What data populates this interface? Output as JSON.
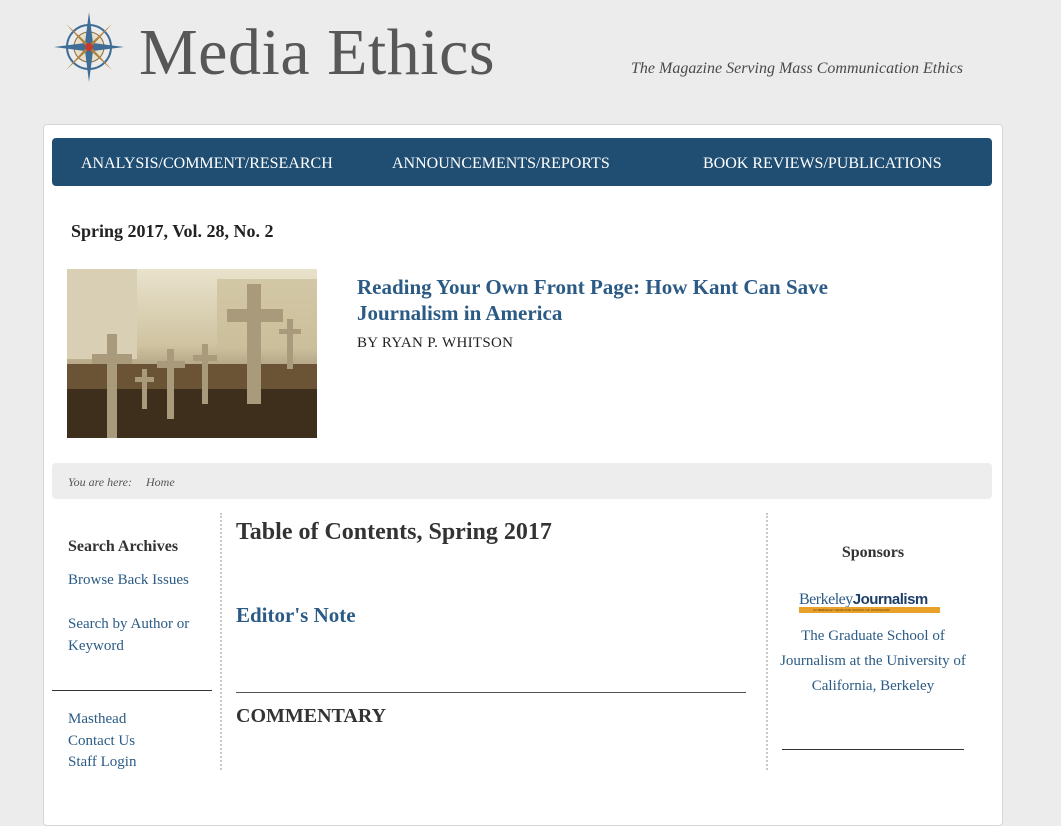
{
  "header": {
    "site_title": "Media Ethics",
    "tagline": "The Magazine Serving Mass Communication Ethics",
    "logo_icon": "compass-rose-icon"
  },
  "nav": {
    "items": [
      {
        "label": "ANALYSIS/COMMENT/RESEARCH"
      },
      {
        "label": "ANNOUNCEMENTS/REPORTS"
      },
      {
        "label": "BOOK REVIEWS/PUBLICATIONS"
      }
    ],
    "color": "#204e73"
  },
  "issue": {
    "label": "Spring 2017, Vol. 28, No. 2"
  },
  "feature": {
    "title": "Reading Your Own Front Page: How Kant Can Save Journalism in America",
    "author": "BY RYAN P. WHITSON",
    "image": "cemetery-crosses-photo"
  },
  "breadcrumb": {
    "label": "You are here:",
    "home": "Home"
  },
  "sidebar": {
    "heading": "Search Archives",
    "links": [
      {
        "label": "Browse Back Issues"
      },
      {
        "label": "Search by Author or Keyword"
      }
    ],
    "links2": [
      {
        "label": "Masthead"
      },
      {
        "label": "Contact Us"
      },
      {
        "label": "Staff Login"
      }
    ]
  },
  "main": {
    "title": "Table of Contents, Spring 2017",
    "editors_note": "Editor's Note",
    "section": "COMMENTARY"
  },
  "sponsors": {
    "heading": "Sponsors",
    "logo_text_1": "Berkeley",
    "logo_text_2": "Journalism",
    "logo_subtext": "UC BERKELEY GRADUATE SCHOOL OF JOURNALISM",
    "description": "The Graduate School of Journalism at the University of California, Berkeley"
  },
  "colors": {
    "link": "#2b5b85",
    "background": "#ececec"
  }
}
